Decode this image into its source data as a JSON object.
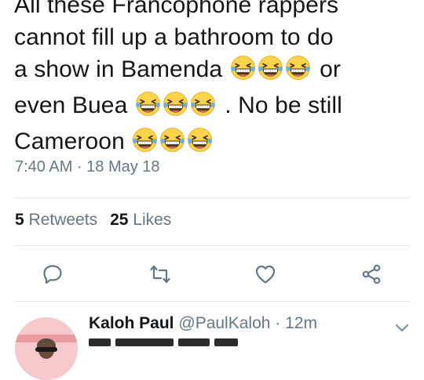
{
  "tweet": {
    "lines": [
      {
        "text": "All these Francophone rappers",
        "emoji_after": 0,
        "suffix": ""
      },
      {
        "text": "cannot fill up a bathroom to do",
        "emoji_after": 0,
        "suffix": ""
      },
      {
        "text": "a show in Bamenda",
        "emoji_after": 3,
        "suffix": "or"
      },
      {
        "text": "even Buea",
        "emoji_after": 3,
        "suffix": ". No be still"
      },
      {
        "text": "Cameroon",
        "emoji_after": 3,
        "suffix": ""
      }
    ],
    "emoji_icon": "grinning-squinting-face-icon",
    "timestamp": "7:40 AM · 18 May 18",
    "retweets_count": "5",
    "retweets_label": "Retweets",
    "likes_count": "25",
    "likes_label": "Likes"
  },
  "actions": {
    "reply_icon": "reply-icon",
    "retweet_icon": "retweet-icon",
    "like_icon": "heart-icon",
    "share_icon": "share-icon"
  },
  "reply": {
    "name": "Kaloh Paul",
    "handle": "@PaulKaloh",
    "separator": "·",
    "time": "12m",
    "menu_icon": "chevron-down-icon"
  },
  "colors": {
    "text": "#14171a",
    "secondary": "#657786",
    "divider": "#e1e8ed",
    "icon": "#657786",
    "emoji_face": "#fdd34c"
  }
}
